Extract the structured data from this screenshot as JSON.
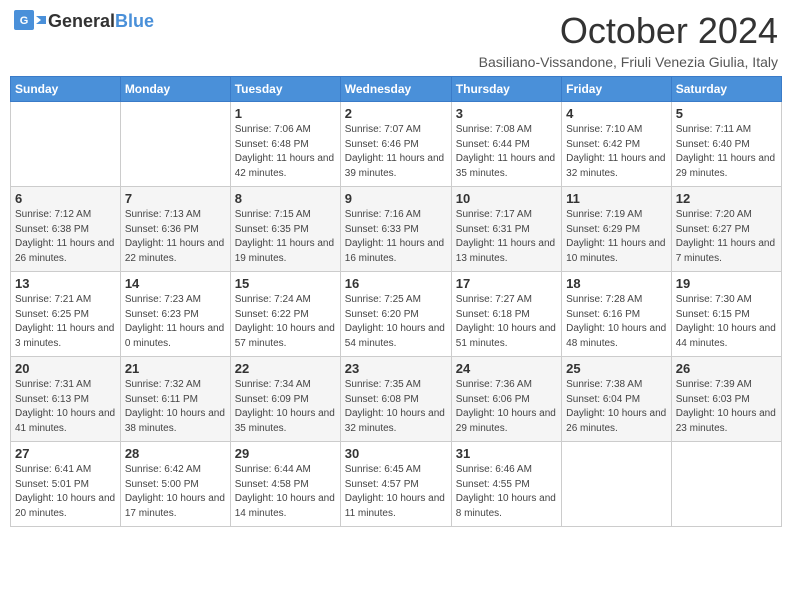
{
  "header": {
    "logo_general": "General",
    "logo_blue": "Blue",
    "month_title": "October 2024",
    "subtitle": "Basiliano-Vissandone, Friuli Venezia Giulia, Italy"
  },
  "calendar": {
    "days_of_week": [
      "Sunday",
      "Monday",
      "Tuesday",
      "Wednesday",
      "Thursday",
      "Friday",
      "Saturday"
    ],
    "weeks": [
      [
        {
          "day": "",
          "sunrise": "",
          "sunset": "",
          "daylight": ""
        },
        {
          "day": "",
          "sunrise": "",
          "sunset": "",
          "daylight": ""
        },
        {
          "day": "1",
          "sunrise": "Sunrise: 7:06 AM",
          "sunset": "Sunset: 6:48 PM",
          "daylight": "Daylight: 11 hours and 42 minutes."
        },
        {
          "day": "2",
          "sunrise": "Sunrise: 7:07 AM",
          "sunset": "Sunset: 6:46 PM",
          "daylight": "Daylight: 11 hours and 39 minutes."
        },
        {
          "day": "3",
          "sunrise": "Sunrise: 7:08 AM",
          "sunset": "Sunset: 6:44 PM",
          "daylight": "Daylight: 11 hours and 35 minutes."
        },
        {
          "day": "4",
          "sunrise": "Sunrise: 7:10 AM",
          "sunset": "Sunset: 6:42 PM",
          "daylight": "Daylight: 11 hours and 32 minutes."
        },
        {
          "day": "5",
          "sunrise": "Sunrise: 7:11 AM",
          "sunset": "Sunset: 6:40 PM",
          "daylight": "Daylight: 11 hours and 29 minutes."
        }
      ],
      [
        {
          "day": "6",
          "sunrise": "Sunrise: 7:12 AM",
          "sunset": "Sunset: 6:38 PM",
          "daylight": "Daylight: 11 hours and 26 minutes."
        },
        {
          "day": "7",
          "sunrise": "Sunrise: 7:13 AM",
          "sunset": "Sunset: 6:36 PM",
          "daylight": "Daylight: 11 hours and 22 minutes."
        },
        {
          "day": "8",
          "sunrise": "Sunrise: 7:15 AM",
          "sunset": "Sunset: 6:35 PM",
          "daylight": "Daylight: 11 hours and 19 minutes."
        },
        {
          "day": "9",
          "sunrise": "Sunrise: 7:16 AM",
          "sunset": "Sunset: 6:33 PM",
          "daylight": "Daylight: 11 hours and 16 minutes."
        },
        {
          "day": "10",
          "sunrise": "Sunrise: 7:17 AM",
          "sunset": "Sunset: 6:31 PM",
          "daylight": "Daylight: 11 hours and 13 minutes."
        },
        {
          "day": "11",
          "sunrise": "Sunrise: 7:19 AM",
          "sunset": "Sunset: 6:29 PM",
          "daylight": "Daylight: 11 hours and 10 minutes."
        },
        {
          "day": "12",
          "sunrise": "Sunrise: 7:20 AM",
          "sunset": "Sunset: 6:27 PM",
          "daylight": "Daylight: 11 hours and 7 minutes."
        }
      ],
      [
        {
          "day": "13",
          "sunrise": "Sunrise: 7:21 AM",
          "sunset": "Sunset: 6:25 PM",
          "daylight": "Daylight: 11 hours and 3 minutes."
        },
        {
          "day": "14",
          "sunrise": "Sunrise: 7:23 AM",
          "sunset": "Sunset: 6:23 PM",
          "daylight": "Daylight: 11 hours and 0 minutes."
        },
        {
          "day": "15",
          "sunrise": "Sunrise: 7:24 AM",
          "sunset": "Sunset: 6:22 PM",
          "daylight": "Daylight: 10 hours and 57 minutes."
        },
        {
          "day": "16",
          "sunrise": "Sunrise: 7:25 AM",
          "sunset": "Sunset: 6:20 PM",
          "daylight": "Daylight: 10 hours and 54 minutes."
        },
        {
          "day": "17",
          "sunrise": "Sunrise: 7:27 AM",
          "sunset": "Sunset: 6:18 PM",
          "daylight": "Daylight: 10 hours and 51 minutes."
        },
        {
          "day": "18",
          "sunrise": "Sunrise: 7:28 AM",
          "sunset": "Sunset: 6:16 PM",
          "daylight": "Daylight: 10 hours and 48 minutes."
        },
        {
          "day": "19",
          "sunrise": "Sunrise: 7:30 AM",
          "sunset": "Sunset: 6:15 PM",
          "daylight": "Daylight: 10 hours and 44 minutes."
        }
      ],
      [
        {
          "day": "20",
          "sunrise": "Sunrise: 7:31 AM",
          "sunset": "Sunset: 6:13 PM",
          "daylight": "Daylight: 10 hours and 41 minutes."
        },
        {
          "day": "21",
          "sunrise": "Sunrise: 7:32 AM",
          "sunset": "Sunset: 6:11 PM",
          "daylight": "Daylight: 10 hours and 38 minutes."
        },
        {
          "day": "22",
          "sunrise": "Sunrise: 7:34 AM",
          "sunset": "Sunset: 6:09 PM",
          "daylight": "Daylight: 10 hours and 35 minutes."
        },
        {
          "day": "23",
          "sunrise": "Sunrise: 7:35 AM",
          "sunset": "Sunset: 6:08 PM",
          "daylight": "Daylight: 10 hours and 32 minutes."
        },
        {
          "day": "24",
          "sunrise": "Sunrise: 7:36 AM",
          "sunset": "Sunset: 6:06 PM",
          "daylight": "Daylight: 10 hours and 29 minutes."
        },
        {
          "day": "25",
          "sunrise": "Sunrise: 7:38 AM",
          "sunset": "Sunset: 6:04 PM",
          "daylight": "Daylight: 10 hours and 26 minutes."
        },
        {
          "day": "26",
          "sunrise": "Sunrise: 7:39 AM",
          "sunset": "Sunset: 6:03 PM",
          "daylight": "Daylight: 10 hours and 23 minutes."
        }
      ],
      [
        {
          "day": "27",
          "sunrise": "Sunrise: 6:41 AM",
          "sunset": "Sunset: 5:01 PM",
          "daylight": "Daylight: 10 hours and 20 minutes."
        },
        {
          "day": "28",
          "sunrise": "Sunrise: 6:42 AM",
          "sunset": "Sunset: 5:00 PM",
          "daylight": "Daylight: 10 hours and 17 minutes."
        },
        {
          "day": "29",
          "sunrise": "Sunrise: 6:44 AM",
          "sunset": "Sunset: 4:58 PM",
          "daylight": "Daylight: 10 hours and 14 minutes."
        },
        {
          "day": "30",
          "sunrise": "Sunrise: 6:45 AM",
          "sunset": "Sunset: 4:57 PM",
          "daylight": "Daylight: 10 hours and 11 minutes."
        },
        {
          "day": "31",
          "sunrise": "Sunrise: 6:46 AM",
          "sunset": "Sunset: 4:55 PM",
          "daylight": "Daylight: 10 hours and 8 minutes."
        },
        {
          "day": "",
          "sunrise": "",
          "sunset": "",
          "daylight": ""
        },
        {
          "day": "",
          "sunrise": "",
          "sunset": "",
          "daylight": ""
        }
      ]
    ]
  }
}
